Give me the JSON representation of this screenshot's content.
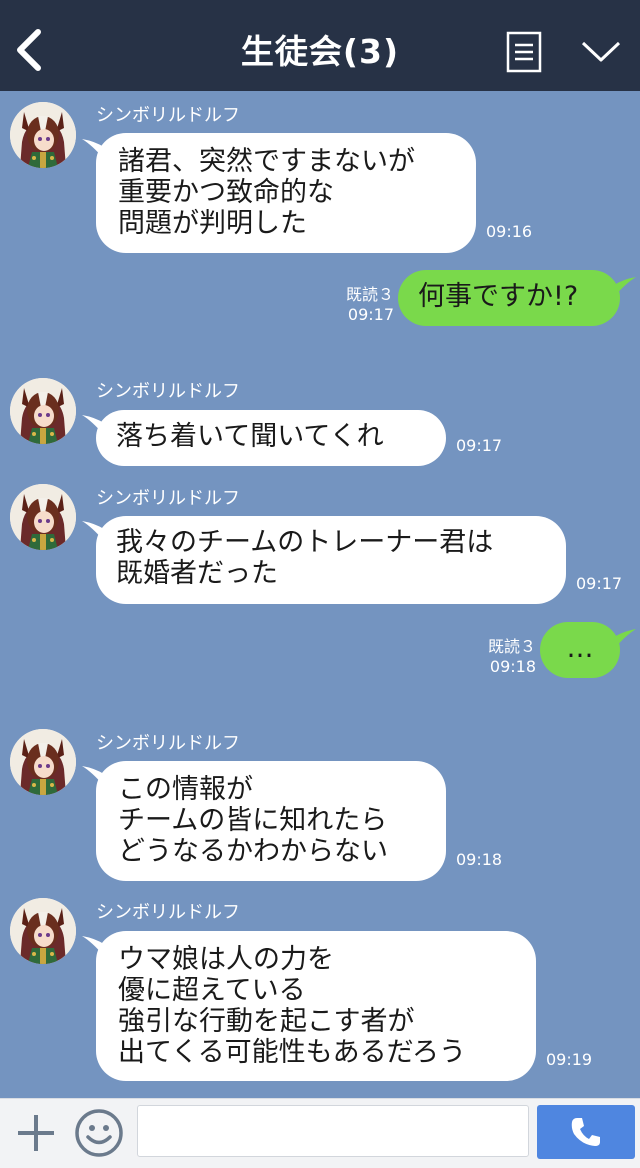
{
  "header": {
    "title": "生徒会(3)"
  },
  "messages": [
    {
      "side": "in",
      "sender": "シンボリルドルフ",
      "lines": [
        "諸君、突然ですまないが",
        "重要かつ致命的な",
        "問題が判明した"
      ],
      "time": "09:16"
    },
    {
      "side": "out",
      "read": "既読３",
      "time": "09:17",
      "lines": [
        "何事ですか!?"
      ]
    },
    {
      "side": "in",
      "sender": "シンボリルドルフ",
      "lines": [
        "落ち着いて聞いてくれ"
      ],
      "time": "09:17"
    },
    {
      "side": "in",
      "sender": "シンボリルドルフ",
      "lines": [
        "我々のチームのトレーナー君は",
        "既婚者だった"
      ],
      "time": "09:17"
    },
    {
      "side": "out",
      "read": "既読３",
      "time": "09:18",
      "lines": [
        "…"
      ]
    },
    {
      "side": "in",
      "sender": "シンボリルドルフ",
      "lines": [
        "この情報が",
        "チームの皆に知れたら",
        "どうなるかわからない"
      ],
      "time": "09:18"
    },
    {
      "side": "in",
      "sender": "シンボリルドルフ",
      "lines": [
        "ウマ娘は人の力を",
        "優に超えている",
        "強引な行動を起こす者が",
        "出てくる可能性もあるだろう"
      ],
      "time": "09:19"
    }
  ],
  "footer": {
    "input_value": ""
  },
  "colors": {
    "header_bg": "#273246",
    "chat_bg": "#7494c0",
    "incoming_bubble": "#ffffff",
    "outgoing_bubble": "#7ad94b",
    "call_button": "#4f86e0"
  },
  "icons": [
    "back-chevron-icon",
    "menu-list-icon",
    "chevron-down-icon",
    "plus-icon",
    "smiley-icon",
    "phone-icon",
    "avatar-image"
  ]
}
